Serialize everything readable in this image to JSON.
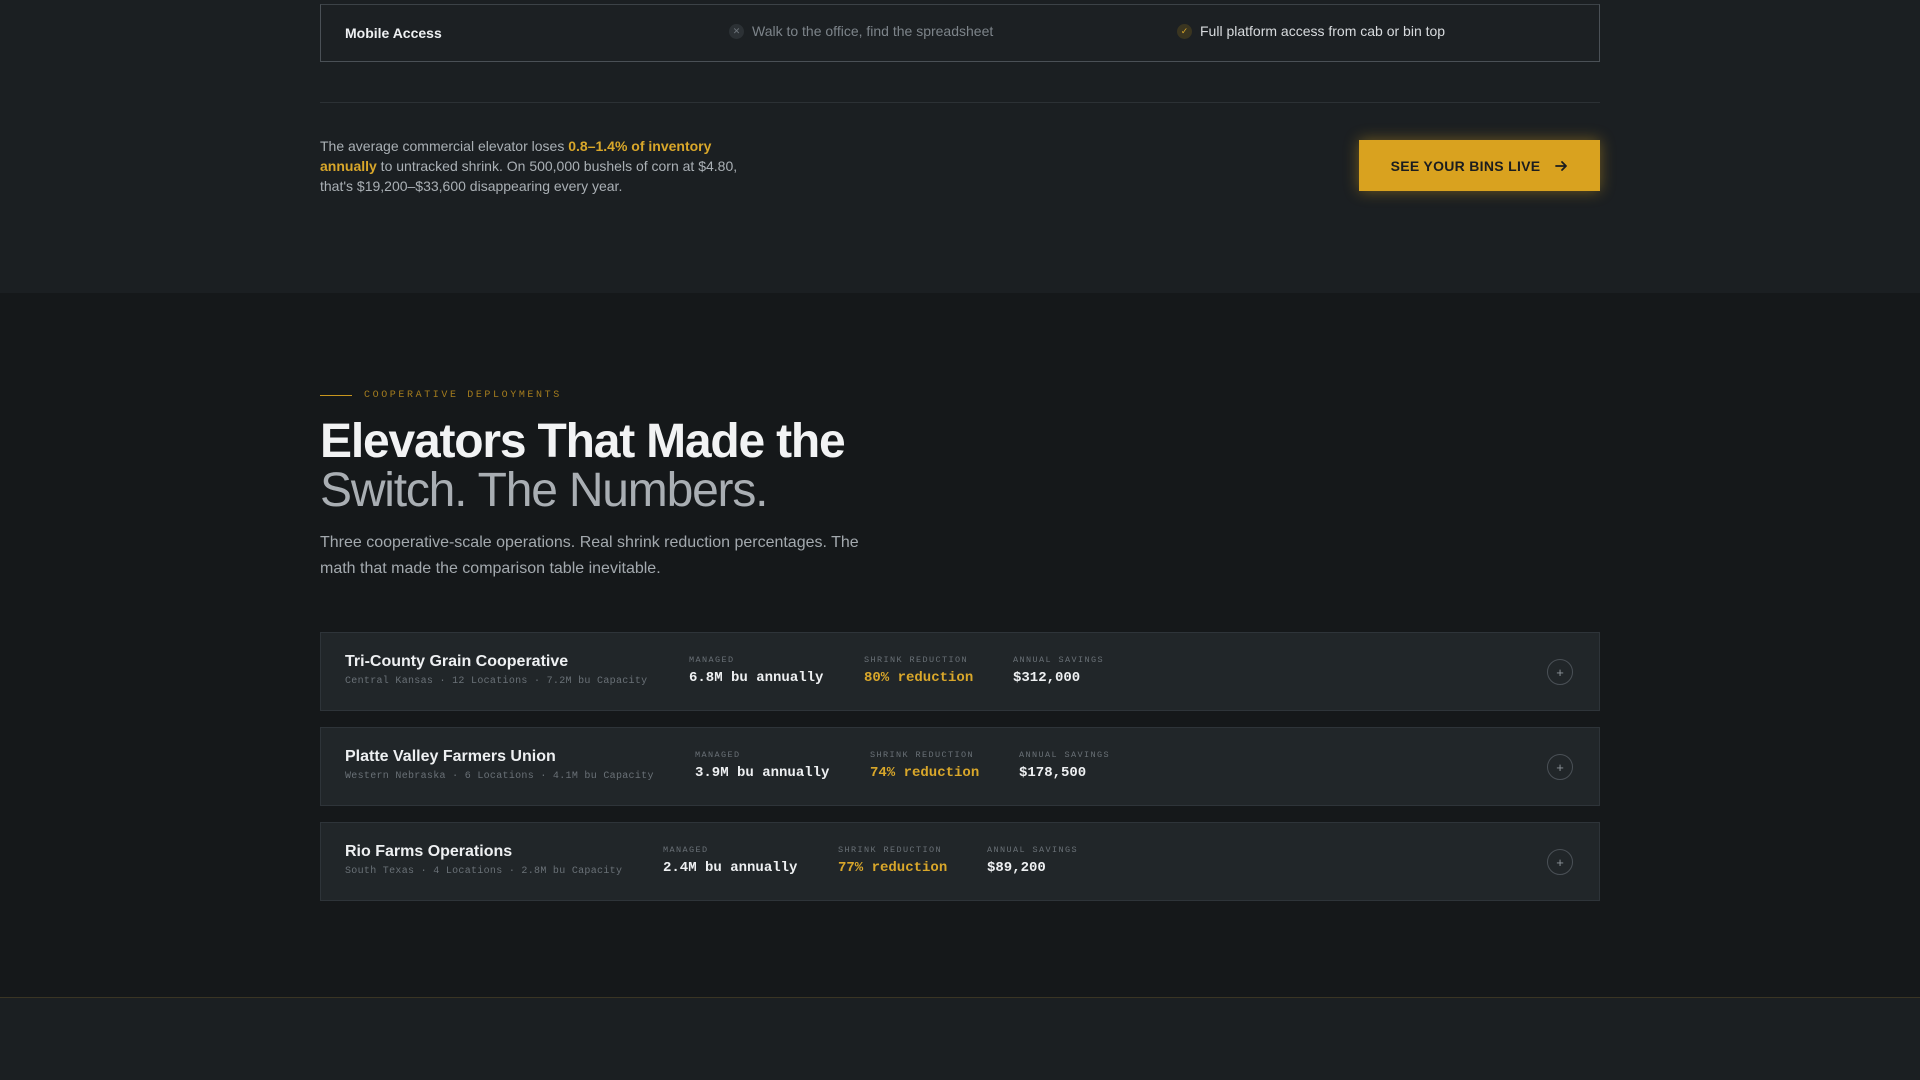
{
  "comparison_row": {
    "feature": "Mobile Access",
    "old_way": "Walk to the office, find the spreadsheet",
    "new_way": "Full platform access from cab or bin top"
  },
  "callout": {
    "prefix": "The average commercial elevator loses ",
    "highlight": "0.8–1.4% of inventory annually",
    "suffix": " to untracked shrink. On 500,000 bushels of corn at $4.80, that's $19,200–$33,600 disappearing every year."
  },
  "cta": {
    "label": "SEE YOUR BINS LIVE"
  },
  "deployments": {
    "eyebrow": "COOPERATIVE DEPLOYMENTS",
    "title_line1": "Elevators That Made the",
    "title_line2": "Switch. The Numbers.",
    "lede": "Three cooperative-scale operations. Real shrink reduction percentages. The math that made the comparison table inevitable.",
    "cards": [
      {
        "name": "Tri-County Grain Cooperative",
        "meta": "Central Kansas · 12 Locations · 7.2M bu Capacity",
        "managed_label": "MANAGED",
        "managed": "6.8M bu annually",
        "shrink_label": "SHRINK REDUCTION",
        "shrink": "80% reduction",
        "savings_label": "ANNUAL SAVINGS",
        "savings": "$312,000"
      },
      {
        "name": "Platte Valley Farmers Union",
        "meta": "Western Nebraska · 6 Locations · 4.1M bu Capacity",
        "managed_label": "MANAGED",
        "managed": "3.9M bu annually",
        "shrink_label": "SHRINK REDUCTION",
        "shrink": "74% reduction",
        "savings_label": "ANNUAL SAVINGS",
        "savings": "$178,500"
      },
      {
        "name": "Rio Farms Operations",
        "meta": "South Texas · 4 Locations · 2.8M bu Capacity",
        "managed_label": "MANAGED",
        "managed": "2.4M bu annually",
        "shrink_label": "SHRINK REDUCTION",
        "shrink": "77% reduction",
        "savings_label": "ANNUAL SAVINGS",
        "savings": "$89,200"
      }
    ]
  },
  "icons": {
    "old_way": "x-circle-icon",
    "new_way": "check-circle-icon",
    "cta": "arrow-right-icon",
    "expand": "plus-circle-icon"
  },
  "colors": {
    "accent": "#d9a21f",
    "background": "#1b1f22",
    "section_background": "#15181a",
    "card_background": "#212629"
  }
}
